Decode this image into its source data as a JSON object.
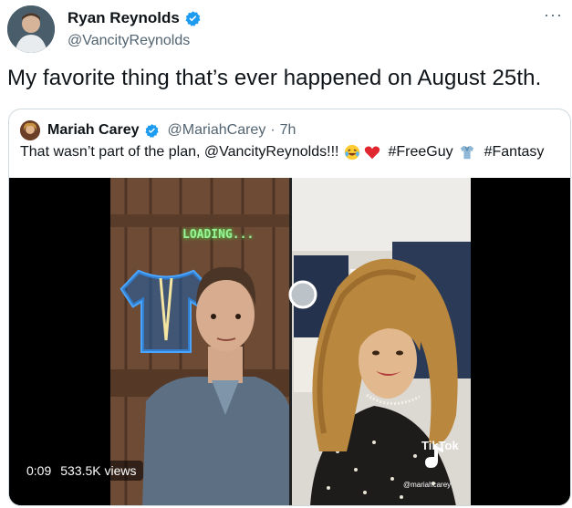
{
  "author": {
    "display_name": "Ryan Reynolds",
    "handle": "@VancityReynolds",
    "verified": true
  },
  "more_label": "···",
  "tweet_text": "My favorite thing that’s ever happened on August 25th.",
  "quoted": {
    "display_name": "Mariah Carey",
    "handle": "@MariahCarey",
    "separator": "·",
    "time": "7h",
    "text_before": "That wasn’t part of the plan, @VancityReynolds!!!",
    "hashtag1": "#FreeGuy",
    "hashtag2": "#Fantasy",
    "emojis": [
      "laughing-tears",
      "red-heart",
      "shirt"
    ]
  },
  "video": {
    "time": "0:09",
    "views": "533.5K views",
    "overlay_loading": "LOADING...",
    "tiktok_label": "TikTok",
    "tiktok_handle": "@mariahcarey"
  },
  "colors": {
    "verified_blue": "#1d9bf0",
    "secondary_text": "#536471",
    "border": "#cfd9de"
  }
}
